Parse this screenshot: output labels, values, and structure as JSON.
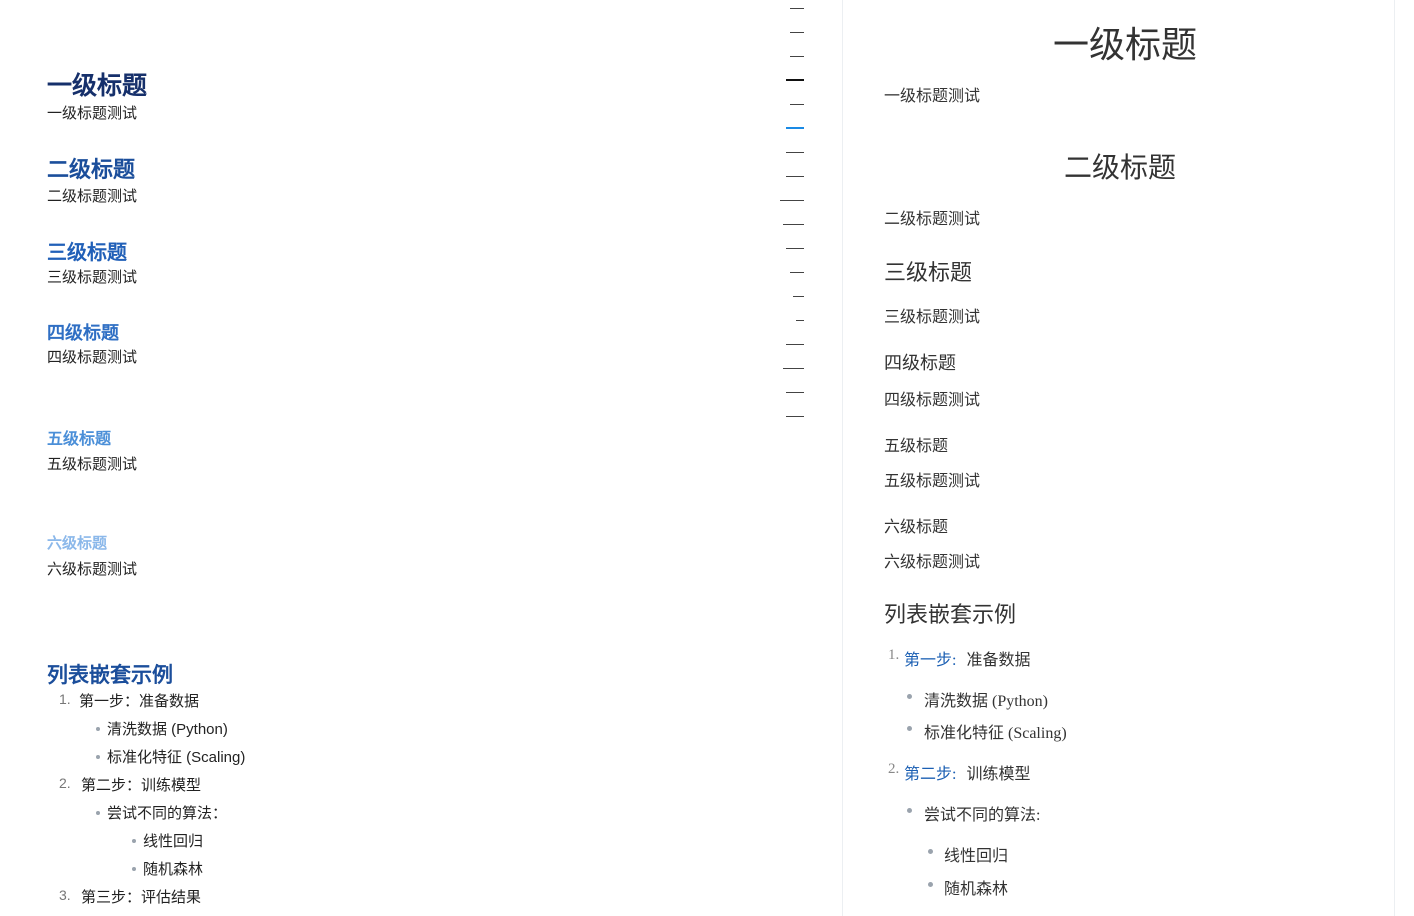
{
  "editor": {
    "h1": "一级标题",
    "p1": "一级标题测试",
    "h2": "二级标题",
    "p2": "二级标题测试",
    "h3": "三级标题",
    "p3": "三级标题测试",
    "h4": "四级标题",
    "p4": "四级标题测试",
    "h5": "五级标题",
    "p5": "五级标题测试",
    "h6": "六级标题",
    "p6": "六级标题测试",
    "list_title": "列表嵌套示例",
    "list": {
      "n1": "1.",
      "item1": "第一步：准备数据",
      "item1_1": "清洗数据 (Python)",
      "item1_2": "标准化特征 (Scaling)",
      "n2": "2.",
      "item2": "第二步：训练模型",
      "item2_1": "尝试不同的算法：",
      "item2_1_1": "线性回归",
      "item2_1_2": "随机森林",
      "n3": "3.",
      "item3": "第三步：评估结果"
    }
  },
  "preview": {
    "h1": "一级标题",
    "p1": "一级标题测试",
    "h2": "二级标题",
    "p2": "二级标题测试",
    "h3": "三级标题",
    "p3": "三级标题测试",
    "h4": "四级标题",
    "p4": "四级标题测试",
    "h5": "五级标题",
    "p5": "五级标题测试",
    "h6": "六级标题",
    "p6": "六级标题测试",
    "list_title": "列表嵌套示例",
    "list": {
      "n1": "1.",
      "item1_strong": "第一步:",
      "item1_rest": "准备数据",
      "item1_1": "清洗数据 (Python)",
      "item1_2": "标准化特征 (Scaling)",
      "n2": "2.",
      "item2_strong": "第二步:",
      "item2_rest": "训练模型",
      "item2_1": "尝试不同的算法:",
      "item2_1_1": "线性回归",
      "item2_1_2": "随机森林"
    }
  },
  "colors": {
    "h1": "#16306b",
    "h2": "#1b4e9b",
    "h3": "#2160b8",
    "h4": "#2f6fc4",
    "h5": "#4b8fd8",
    "h6": "#8bb8ea",
    "outline_active": "#1a8ae5",
    "preview_strong": "#1b5fb3"
  }
}
